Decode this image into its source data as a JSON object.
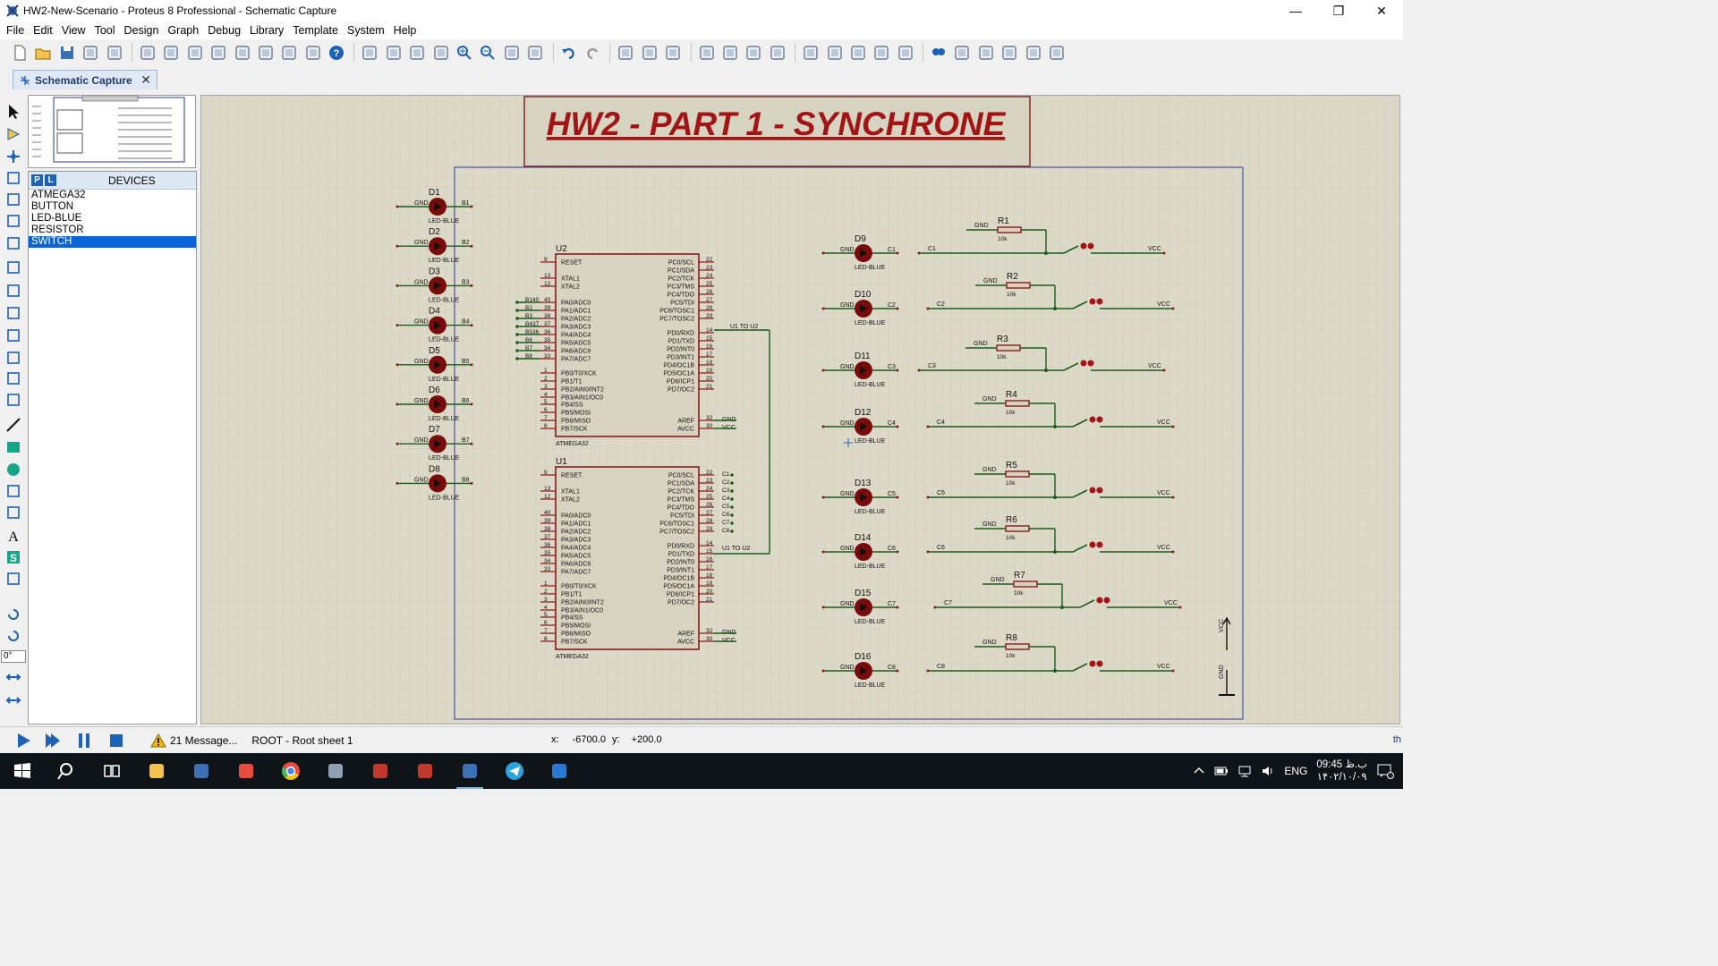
{
  "window": {
    "title": "HW2-New-Scenario - Proteus 8 Professional - Schematic Capture"
  },
  "menu": [
    "File",
    "Edit",
    "View",
    "Tool",
    "Design",
    "Graph",
    "Debug",
    "Library",
    "Template",
    "System",
    "Help"
  ],
  "tab": {
    "label": "Schematic Capture"
  },
  "toolbar_icons": [
    "new-file-icon",
    "open-file-icon",
    "save-icon",
    "import-icon",
    "home-icon",
    "schematic-icon",
    "pcb-icon",
    "3d-viewer-icon",
    "gerber-icon",
    "bom-icon",
    "dollar-icon",
    "vsm-icon",
    "notes-icon",
    "help-icon",
    "refresh-icon",
    "grid-icon",
    "origin-icon",
    "pan-icon",
    "zoom-in-icon",
    "zoom-out-icon",
    "zoom-all-icon",
    "zoom-area-icon",
    "undo-icon",
    "redo-icon",
    "cut-icon",
    "copy-icon",
    "paste-icon",
    "block-copy-icon",
    "block-move-icon",
    "block-rotate-icon",
    "block-delete-icon",
    "pick-device-icon",
    "make-device-icon",
    "packaging-icon",
    "decompose-icon",
    "wire-autorouter-icon",
    "search-icon",
    "property-tool-icon",
    "new-sheet-icon",
    "delete-sheet-icon",
    "goto-sheet-icon",
    "design-explorer-icon"
  ],
  "left_tools": [
    "selection-icon",
    "component-icon",
    "junction-icon",
    "wire-label-icon",
    "text-script-icon",
    "bus-icon",
    "subcircuit-icon",
    "terminals-icon",
    "device-pins-icon",
    "graph-icon",
    "tape-recorder-icon",
    "generator-icon",
    "voltage-probe-icon",
    "current-probe-icon",
    "line-icon",
    "box-icon",
    "circle-icon",
    "arc-icon",
    "path-icon",
    "text-icon",
    "symbol-icon",
    "marker-icon",
    "rotate-cw-icon",
    "rotate-ccw-icon",
    "flip-horizontal-icon",
    "flip-vertical-icon"
  ],
  "angle": "0°",
  "devices": {
    "title": "DEVICES",
    "p_label": "P",
    "l_label": "L",
    "items": [
      "ATMEGA32",
      "BUTTON",
      "LED-BLUE",
      "RESISTOR",
      "SWITCH"
    ],
    "selected": 4
  },
  "schematic": {
    "title": "HW2 - PART 1 - SYNCHRONE",
    "u2": {
      "ref": "U2",
      "part": "ATMEGA32"
    },
    "u1": {
      "ref": "U1",
      "part": "ATMEGA32"
    },
    "left_pins": [
      "RESET",
      "XTAL1",
      "XTAL2",
      "PA0/ADC0",
      "PA1/ADC1",
      "PA2/ADC2",
      "PA3/ADC3",
      "PA4/ADC4",
      "PA5/ADC5",
      "PA6/ADC6",
      "PA7/ADC7",
      "PB0/T0/XCK",
      "PB1/T1",
      "PB2/AIN0/INT2",
      "PB3/AIN1/OC0",
      "PB4/SS",
      "PB5/MOSI",
      "PB6/MISO",
      "PB7/SCK"
    ],
    "left_nums": [
      "9",
      "13",
      "12",
      "40",
      "39",
      "38",
      "37",
      "36",
      "35",
      "34",
      "33",
      "1",
      "2",
      "3",
      "4",
      "5",
      "6",
      "7",
      "8"
    ],
    "right_pins": [
      "PC0/SCL",
      "PC1/SDA",
      "PC2/TCK",
      "PC3/TMS",
      "PC4/TDO",
      "PC5/TDI",
      "PC6/TOSC1",
      "PC7/TOSC2",
      "PD0/RXD",
      "PD1/TXD",
      "PD2/INT0",
      "PD3/INT1",
      "PD4/OC1B",
      "PD5/OC1A",
      "PD6/ICP1",
      "PD7/OC2",
      "AREF",
      "AVCC"
    ],
    "right_nums": [
      "22",
      "23",
      "24",
      "25",
      "26",
      "27",
      "28",
      "29",
      "14",
      "15",
      "16",
      "17",
      "18",
      "19",
      "20",
      "21",
      "32",
      "30"
    ],
    "u2_port_a": [
      "B1",
      "B2",
      "B3",
      "B4",
      "B5",
      "B6",
      "B7",
      "B8"
    ],
    "u2_port_a_alt": [
      "B140",
      "B437",
      "B536"
    ],
    "u1_portc": [
      "C1",
      "C2",
      "C3",
      "C4",
      "C5",
      "C6",
      "C7",
      "C8"
    ],
    "u1_to_u2": "U1 TO U2",
    "gnd": "GND",
    "vcc": "VCC",
    "leds_left": [
      {
        "ref": "D1",
        "net": "B1"
      },
      {
        "ref": "D2",
        "net": "B2"
      },
      {
        "ref": "D3",
        "net": "B3"
      },
      {
        "ref": "D4",
        "net": "B4"
      },
      {
        "ref": "D5",
        "net": "B5"
      },
      {
        "ref": "D6",
        "net": "B6"
      },
      {
        "ref": "D7",
        "net": "B7"
      },
      {
        "ref": "D8",
        "net": "B8"
      }
    ],
    "led_part": "LED-BLUE",
    "right_rows": [
      {
        "led": "D9",
        "net": "C1",
        "res": "R1",
        "val": "10k"
      },
      {
        "led": "D10",
        "net": "C2",
        "res": "R2",
        "val": "10k"
      },
      {
        "led": "D11",
        "net": "C3",
        "res": "R3",
        "val": "10k"
      },
      {
        "led": "D12",
        "net": "C4",
        "res": "R4",
        "val": "10k"
      },
      {
        "led": "D13",
        "net": "C5",
        "res": "R5",
        "val": "10k"
      },
      {
        "led": "D14",
        "net": "C6",
        "res": "R6",
        "val": "10k"
      },
      {
        "led": "D15",
        "net": "C7",
        "res": "R7",
        "val": "10k"
      },
      {
        "led": "D16",
        "net": "C8",
        "res": "R8",
        "val": "10k"
      }
    ]
  },
  "status": {
    "messages": "21 Message...",
    "sheet": "ROOT - Root sheet 1",
    "x_label": "x:",
    "x": "-6700.0",
    "y_label": "y:",
    "y": "+200.0",
    "right": "th"
  },
  "taskbar": {
    "apps": [
      "start-icon",
      "search-icon",
      "task-view-icon",
      "file-explorer-icon",
      "store-icon",
      "fingerprint-app-icon",
      "chrome-icon",
      "user-app-icon",
      "acrobat-icon",
      "raspberry-icon",
      "proteus-icon",
      "telegram-icon",
      "vscode-icon"
    ],
    "active": 10,
    "lang": "ENG",
    "time": "09:45 ب.ظ",
    "date": "۱۴۰۲/۱۰/۰۹"
  }
}
